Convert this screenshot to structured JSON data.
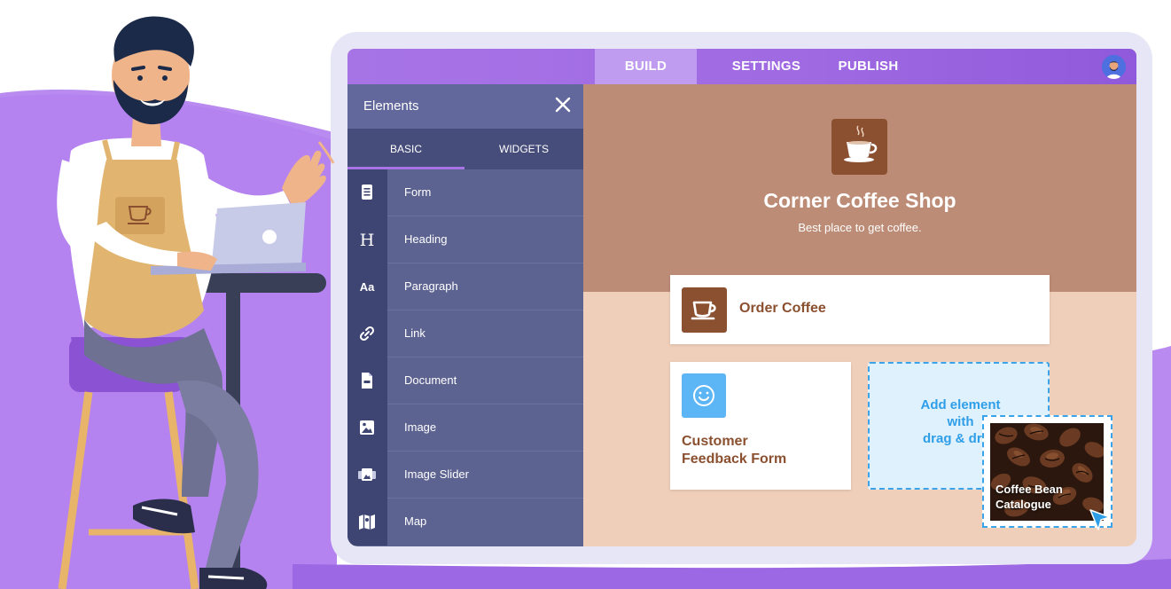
{
  "topbar": {
    "tabs": [
      {
        "label": "BUILD",
        "active": true
      },
      {
        "label": "SETTINGS",
        "active": false
      },
      {
        "label": "PUBLISH",
        "active": false
      }
    ],
    "avatar_icon": "user-avatar-icon"
  },
  "panel": {
    "title": "Elements",
    "close_icon": "close-icon",
    "tabs": [
      {
        "label": "BASIC",
        "active": true
      },
      {
        "label": "WIDGETS",
        "active": false
      }
    ],
    "items": [
      {
        "label": "Form",
        "icon": "form-icon"
      },
      {
        "label": "Heading",
        "icon": "heading-icon"
      },
      {
        "label": "Paragraph",
        "icon": "paragraph-icon"
      },
      {
        "label": "Link",
        "icon": "link-icon"
      },
      {
        "label": "Document",
        "icon": "document-icon"
      },
      {
        "label": "Image",
        "icon": "image-icon"
      },
      {
        "label": "Image Slider",
        "icon": "image-slider-icon"
      },
      {
        "label": "Map",
        "icon": "map-icon"
      }
    ]
  },
  "canvas": {
    "title": "Corner Coffee Shop",
    "subtitle": "Best place to get coffee.",
    "order_card": {
      "label": "Order Coffee",
      "icon": "coffee-cup-icon"
    },
    "feedback_card": {
      "line1": "Customer",
      "line2": "Feedback Form",
      "icon": "smiley-icon"
    },
    "drop_zone": {
      "line1": "Add element",
      "line2": "with",
      "line3": "drag & drop"
    },
    "drag_card": {
      "line1": "Coffee Bean",
      "line2": "Catalogue"
    }
  },
  "colors": {
    "brand_purple": "#a774e6",
    "panel_bg": "#5d6391",
    "hero_brown": "#bd8c76",
    "coffee_brown": "#8b5030",
    "accent_blue": "#3aa3ea"
  }
}
